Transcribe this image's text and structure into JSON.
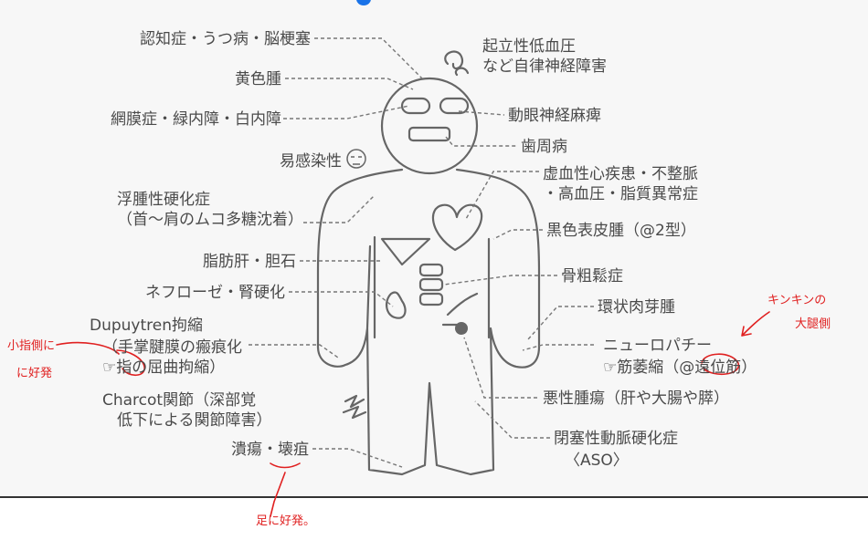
{
  "labels": {
    "dementia": "認知症・うつ病・脳梗塞",
    "orthostatic": [
      "起立性低血圧",
      "など自律神経障害"
    ],
    "xanthoma": "黄色腫",
    "eye": "網膜症・緑内障・白内障",
    "oculomotor": "動眼神経麻痺",
    "periodontal": "歯周病",
    "infection": "易感染性",
    "cardiac": [
      "虚血性心疾患・不整脈",
      "・高血圧・脂質異常症"
    ],
    "scleredema": [
      "浮腫性硬化症",
      "（首〜肩のムコ多糖沈着）"
    ],
    "acanthosis": "黒色表皮腫（@2型）",
    "liver": "脂肪肝・胆石",
    "osteoporosis": "骨粗鬆症",
    "nephro": "ネフローゼ・腎硬化",
    "granuloma": "環状肉芽腫",
    "dupuytren": [
      "Dupuytren拘縮",
      "（手掌腱膜の瘢痕化",
      "☞指の屈曲拘縮）"
    ],
    "neuropathy": [
      "ニューロパチー",
      "☞筋萎縮（@遠位筋）"
    ],
    "charcot": [
      "Charcot関節（深部覚",
      "低下による関節障害）"
    ],
    "malignancy": "悪性腫瘍（肝や大腸や膵）",
    "ulcer": "潰瘍・壊疽",
    "aso": [
      "閉塞性動脈硬化症",
      "〈ASO〉"
    ]
  },
  "handwritten": {
    "little_finger": [
      "小指側に",
      "に好発"
    ],
    "proximal": [
      "キンキンの",
      "大腿側"
    ],
    "foot": "足に好発。"
  },
  "colors": {
    "text": "#4a4a4a",
    "line": "#666666",
    "annotation": "#e02020",
    "accent": "#1a73e8"
  }
}
